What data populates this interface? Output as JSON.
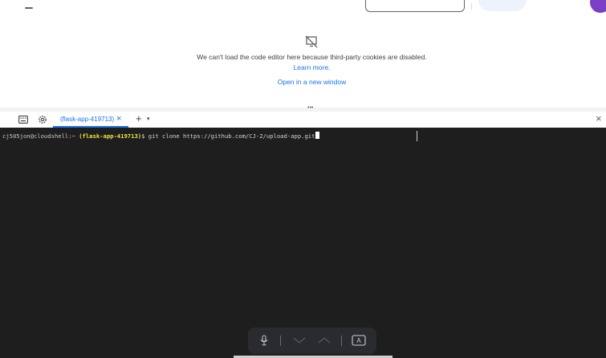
{
  "editor": {
    "message": "We can't load the code editor here because third-party cookies are disabled.",
    "learn_more": "Learn more.",
    "open_window": "Open in a new window",
    "splitter_handle": "•••"
  },
  "tabs": [
    {
      "label": "(flask-app-419713)",
      "close": "×",
      "active": true
    }
  ],
  "tabbar": {
    "add_tab": "+",
    "tab_menu": "▾",
    "close_panel": "×"
  },
  "terminal": {
    "user_host": "cj505jon@cloudshell:~",
    "project": "(flask-app-419713)",
    "prompt_symbol": "$",
    "command": "git clone https://github.com/CJ-2/upload-app.git"
  },
  "floating_toolbar": {
    "icons": [
      "microphone-icon",
      "chevron-down-icon",
      "chevron-up-icon",
      "keyboard-a-icon"
    ],
    "keyboard_key": "A"
  },
  "colors": {
    "accent": "#1a73e8",
    "terminal_bg": "#1e1e1e",
    "project_highlight": "#f0e442"
  }
}
